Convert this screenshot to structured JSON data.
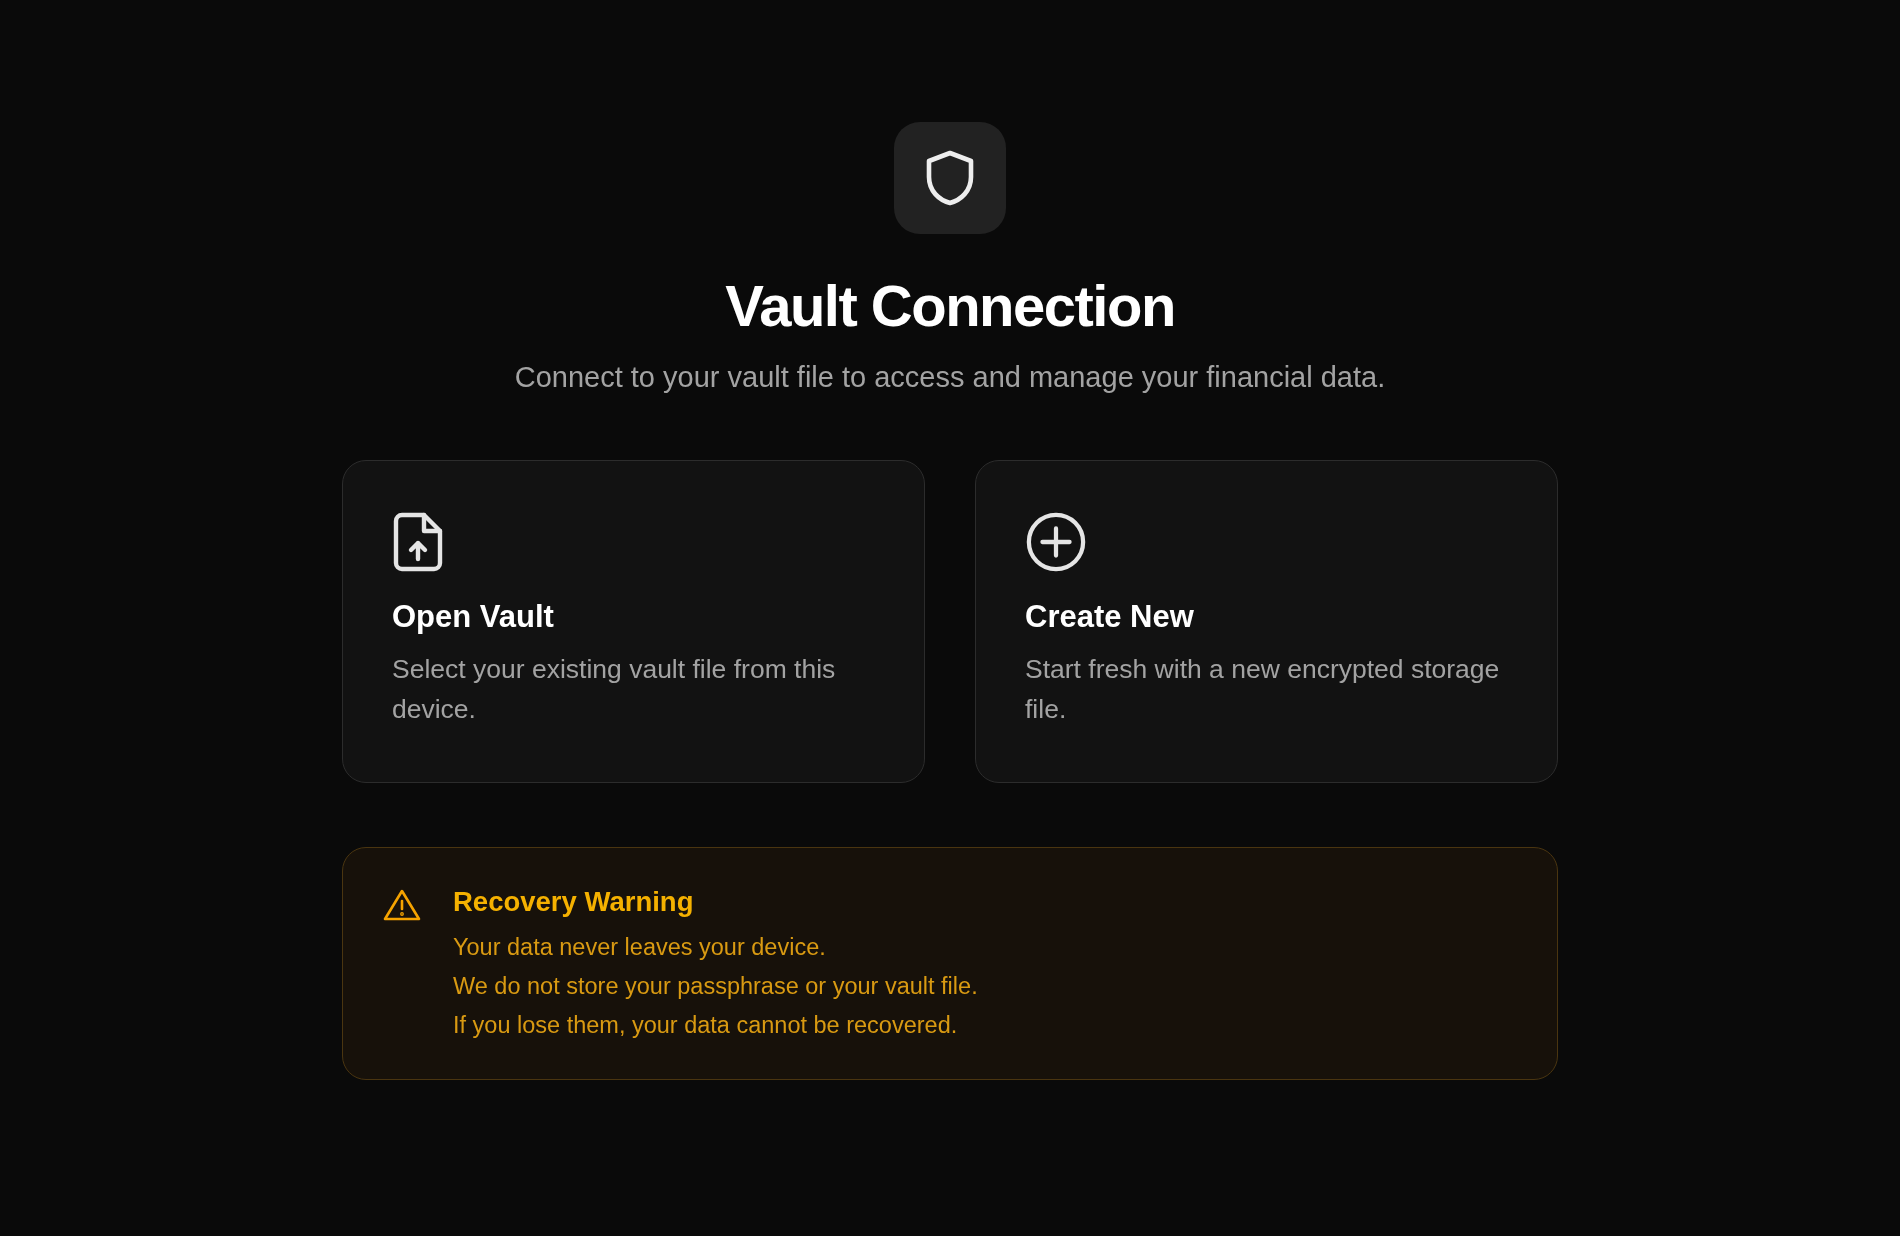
{
  "header": {
    "title": "Vault Connection",
    "subtitle": "Connect to your vault file to access and manage your financial data."
  },
  "options": [
    {
      "kind": "open",
      "title": "Open Vault",
      "description": "Select your existing vault file from this device."
    },
    {
      "kind": "create",
      "title": "Create New",
      "description": "Start fresh with a new encrypted storage file."
    }
  ],
  "warning": {
    "title": "Recovery Warning",
    "lines": [
      "Your data never leaves your device.",
      "We do not store your passphrase or your vault file.",
      "If you lose them, your data cannot be recovered."
    ]
  }
}
